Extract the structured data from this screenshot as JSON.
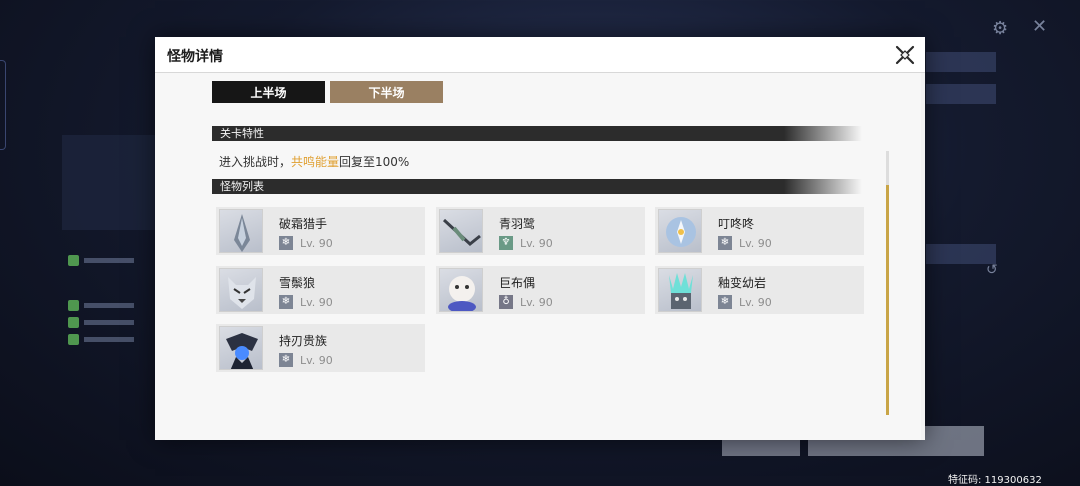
{
  "dialog": {
    "title": "怪物详情",
    "tabs": [
      {
        "label": "上半场",
        "active": true
      },
      {
        "label": "下半场",
        "active": false
      }
    ],
    "stage_section": {
      "label": "关卡特性",
      "text_before": "进入挑战时，",
      "text_highlight": "共鸣能量",
      "text_after": "回复至100%"
    },
    "monster_section": {
      "label": "怪物列表",
      "monsters": [
        {
          "name": "破霜猎手",
          "element": "frost",
          "level": "Lv. 90"
        },
        {
          "name": "青羽鹭",
          "element": "aero",
          "level": "Lv. 90"
        },
        {
          "name": "叮咚咚",
          "element": "frost",
          "level": "Lv. 90"
        },
        {
          "name": "雪鬃狼",
          "element": "frost",
          "level": "Lv. 90"
        },
        {
          "name": "巨布偶",
          "element": "havoc",
          "level": "Lv. 90"
        },
        {
          "name": "釉变幼岩",
          "element": "frost",
          "level": "Lv. 90"
        },
        {
          "name": "持刃贵族",
          "element": "frost",
          "level": "Lv. 90"
        }
      ]
    }
  },
  "feature_code": "特征码: 119300632",
  "colors": {
    "accent_gold": "#c9a547",
    "highlight_orange": "#e0a032",
    "tab_active": "#161616",
    "tab_inactive": "#9a8062"
  }
}
